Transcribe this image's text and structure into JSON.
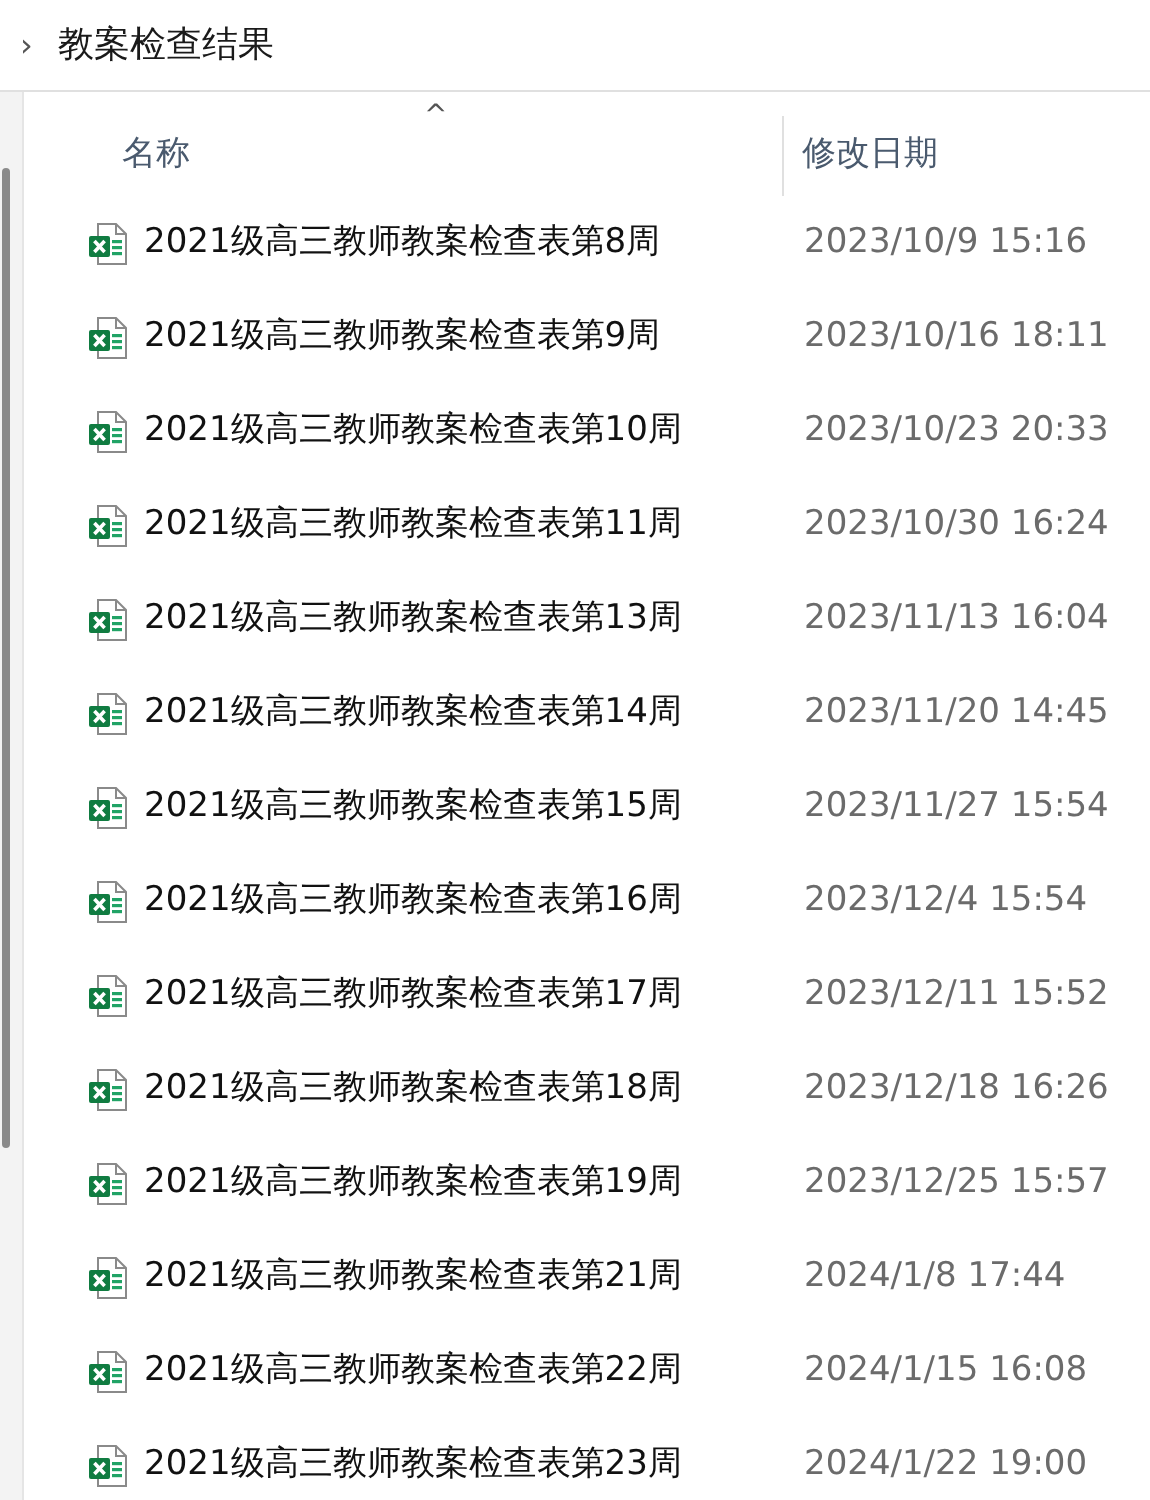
{
  "breadcrumb": {
    "chevron": "›",
    "title": "教案检查结果"
  },
  "table": {
    "sort_indicator": "^",
    "columns": [
      "名称",
      "修改日期"
    ],
    "rows": [
      {
        "name": "2021级高三教师教案检查表第8周",
        "modified": "2023/10/9 15:16"
      },
      {
        "name": "2021级高三教师教案检查表第9周",
        "modified": "2023/10/16 18:11"
      },
      {
        "name": "2021级高三教师教案检查表第10周",
        "modified": "2023/10/23 20:33"
      },
      {
        "name": "2021级高三教师教案检查表第11周",
        "modified": "2023/10/30 16:24"
      },
      {
        "name": "2021级高三教师教案检查表第13周",
        "modified": "2023/11/13 16:04"
      },
      {
        "name": "2021级高三教师教案检查表第14周",
        "modified": "2023/11/20 14:45"
      },
      {
        "name": "2021级高三教师教案检查表第15周",
        "modified": "2023/11/27 15:54"
      },
      {
        "name": "2021级高三教师教案检查表第16周",
        "modified": "2023/12/4 15:54"
      },
      {
        "name": "2021级高三教师教案检查表第17周",
        "modified": "2023/12/11 15:52"
      },
      {
        "name": "2021级高三教师教案检查表第18周",
        "modified": "2023/12/18 16:26"
      },
      {
        "name": "2021级高三教师教案检查表第19周",
        "modified": "2023/12/25 15:57"
      },
      {
        "name": "2021级高三教师教案检查表第21周",
        "modified": "2024/1/8 17:44"
      },
      {
        "name": "2021级高三教师教案检查表第22周",
        "modified": "2024/1/15 16:08"
      },
      {
        "name": "2021级高三教师教案检查表第23周",
        "modified": "2024/1/22 19:00"
      }
    ]
  }
}
